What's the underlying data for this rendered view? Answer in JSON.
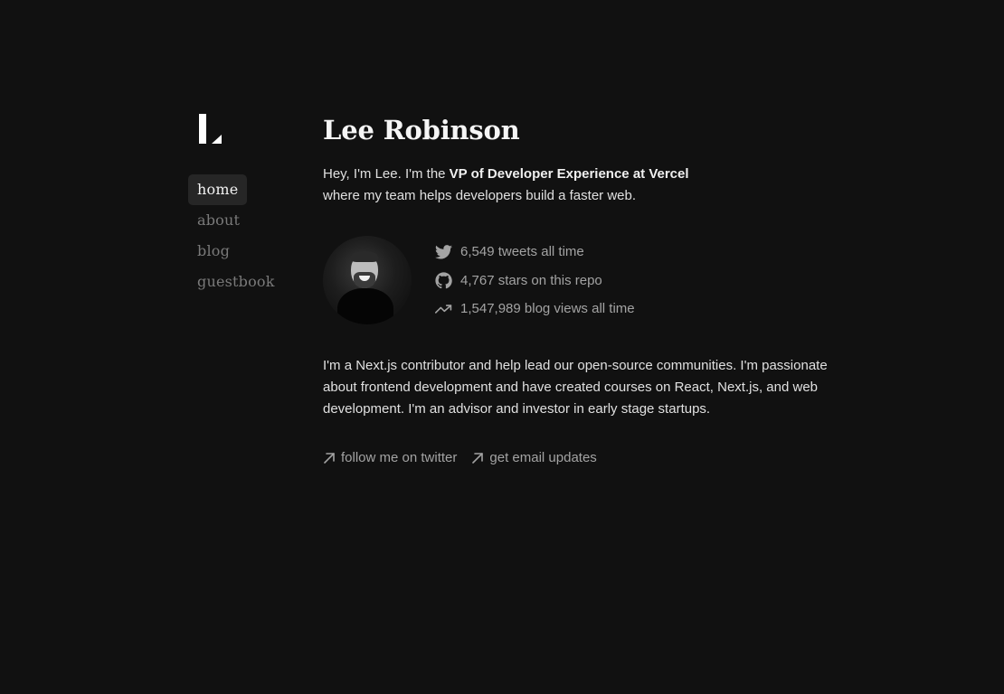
{
  "sidebar": {
    "nav": [
      {
        "label": "home",
        "active": true
      },
      {
        "label": "about",
        "active": false
      },
      {
        "label": "blog",
        "active": false
      },
      {
        "label": "guestbook",
        "active": false
      }
    ]
  },
  "main": {
    "title": "Lee Robinson",
    "intro": {
      "prefix": "Hey, I'm Lee. I'm the ",
      "bold": "VP of Developer Experience at Vercel",
      "suffix": "where my team helps developers build a faster web."
    },
    "stats": [
      {
        "icon": "twitter-icon",
        "text": "6,549 tweets all time"
      },
      {
        "icon": "github-icon",
        "text": "4,767 stars on this repo"
      },
      {
        "icon": "trending-up-icon",
        "text": "1,547,989 blog views all time"
      }
    ],
    "bio": "I'm a Next.js contributor and help lead our open-source communities. I'm passionate about frontend development and have created courses on React, Next.js, and web development. I'm an advisor and investor in early stage startups.",
    "links": [
      {
        "icon": "arrow-up-right-icon",
        "label": "follow me on twitter"
      },
      {
        "icon": "arrow-up-right-icon",
        "label": "get email updates"
      }
    ]
  },
  "colors": {
    "background": "#111111",
    "active_nav_bg": "#262626",
    "muted_text": "#a3a3a3",
    "nav_text": "#7a7a7a"
  }
}
